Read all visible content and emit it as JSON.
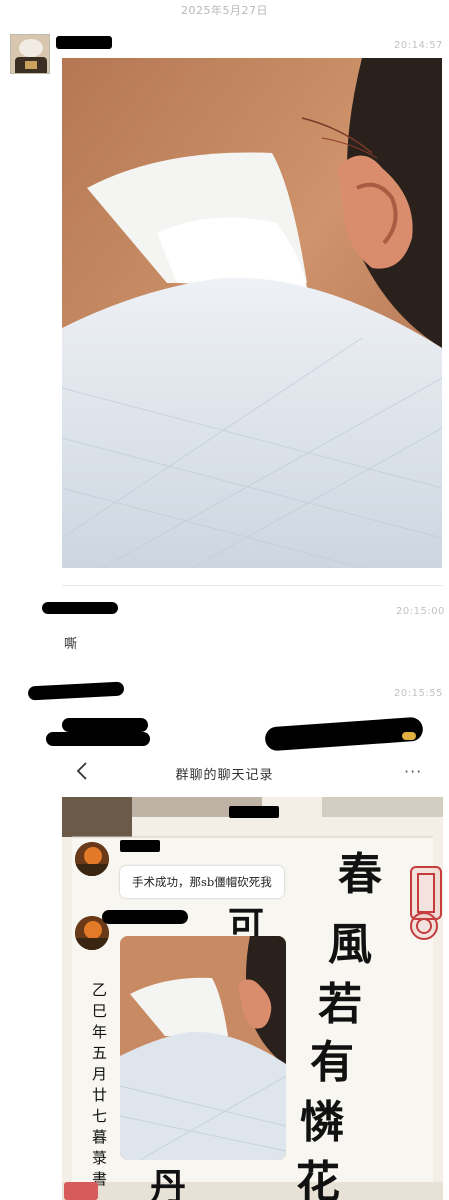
{
  "header": {
    "date": "2025年5月27日"
  },
  "messages": [
    {
      "time": "20:14:57",
      "type": "image"
    },
    {
      "time": "20:15:00",
      "text": "嘶"
    },
    {
      "time": "20:15:55",
      "type": "chat-record"
    }
  ],
  "record": {
    "title": "群聊的聊天记录",
    "back_icon": "chevron-left-icon",
    "more_icon": "ellipsis-icon",
    "more_label": "···",
    "bubble_text": "手术成功，那sb僵帽砍死我"
  },
  "calligraphy": {
    "main_chars": [
      "春",
      "風",
      "若",
      "有",
      "憐",
      "花"
    ],
    "left_chars": [
      "可",
      "丹"
    ],
    "inscription": "乙巳年五月廿七 暮 菉 書"
  },
  "colors": {
    "skin": "#c88a63",
    "cloth": "#dfe5ec",
    "seal": "#c43c3c",
    "timestamp": "#c2c2c2"
  }
}
